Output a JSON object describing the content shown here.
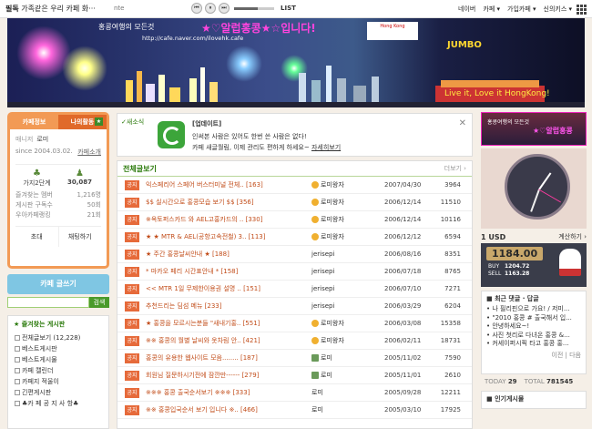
{
  "topbar": {
    "title_bold": "필독",
    "title_rest": "가족같은 우리 카페 화···",
    "music_name": "nte",
    "player_prev": "⏮",
    "player_pause": "⏸",
    "player_next": "⏭",
    "list_label": "LIST",
    "nav": [
      "네이버",
      "카페 ▾",
      "가입카페 ▾",
      "신의키스 ▾"
    ]
  },
  "banner": {
    "line1": "홍콩여행의 모든것",
    "url": "http://cafe.naver.com/ilovehk.cafe",
    "heading": "★♡알럽홍콩★☆입니다!",
    "logo_text": "Hong Kong",
    "jumbo": "JUMBO",
    "slogan": "Live it, Love it HongKong!"
  },
  "profile": {
    "tab_info": "카페정보",
    "tab_activity": "나의활동",
    "level": "매니저",
    "name": "로미",
    "since": "since 2004.03.02.",
    "intro_link": "카페소개",
    "stat1_label": "가지2단계",
    "stat2_value": "30,087",
    "list": [
      {
        "label": "즐겨찾는 멤버",
        "value": "1,216명"
      },
      {
        "label": "게시판 구독수",
        "value": "50회"
      },
      {
        "label": "우아카페랭킹",
        "value": "21회"
      }
    ],
    "btn_invite": "초대",
    "btn_chat": "채팅하기"
  },
  "write_button": "카페 글쓰기",
  "search_button": "검색",
  "favorites": {
    "heading": "즐겨찾는 게시판",
    "items": [
      "전체글보기 (12,228)",
      "베스트게시판",
      "베스트게시물",
      "카페 캘린더",
      "카페지 적울이",
      "긴편게시판",
      "♣카 페 공 지 사 항♣"
    ]
  },
  "notice": {
    "label": "새소식",
    "title": "[업데이트]",
    "line1": "인써본 사람은 있어도 한번 쓴 사람은 없다!",
    "line2": "카페 새글월림, 이제 관리도 편하게 하세요~",
    "line2_link": "자세히보기",
    "close": "✕"
  },
  "board": {
    "title": "전체글보기",
    "more": "더보기 ›",
    "tag": "공지",
    "rows": [
      {
        "title": "익스페리어 스페어 버스터미널 전체..",
        "count": "[163]",
        "author": "로미왕자",
        "face": "emoji",
        "date": "2007/04/30",
        "views": "3964"
      },
      {
        "title": "$$ 실시간으로 홍콩모습 보기 $$",
        "count": "[356]",
        "author": "로미왕자",
        "face": "emoji",
        "date": "2006/12/14",
        "views": "11510"
      },
      {
        "title": "※옥토퍼스카드 와 AEL고홍카드의 ..",
        "count": "[330]",
        "author": "로미왕자",
        "face": "emoji",
        "date": "2006/12/14",
        "views": "10116"
      },
      {
        "title": "★ ★ MTR & AEL(공항고속전철) 3..",
        "count": "[113]",
        "author": "로미왕자",
        "face": "emoji",
        "date": "2006/12/12",
        "views": "6594"
      },
      {
        "title": "★ 주간 홍콩날씨안내 ★",
        "count": "[188]",
        "author": "jerisepi",
        "face": "",
        "date": "2006/08/16",
        "views": "8351"
      },
      {
        "title": "* 마카오 페리 시간표안내 *",
        "count": "[158]",
        "author": "jerisepi",
        "face": "",
        "date": "2006/07/18",
        "views": "8765"
      },
      {
        "title": "<< MTR 1일 무제한이용권 설명 ..",
        "count": "[151]",
        "author": "jerisepi",
        "face": "",
        "date": "2006/07/10",
        "views": "7271"
      },
      {
        "title": "추천드리는 딤섬 메뉴",
        "count": "[233]",
        "author": "jerisepi",
        "face": "",
        "date": "2006/03/29",
        "views": "6204"
      },
      {
        "title": "★ 홍콩을 모르시는분들 \"새내기홍..",
        "count": "[551]",
        "author": "로미왕자",
        "face": "emoji",
        "date": "2006/03/08",
        "views": "15358"
      },
      {
        "title": "※※ 홍콩의 월별 날씨와 옷차림 안..",
        "count": "[421]",
        "author": "로미왕자",
        "face": "emoji",
        "date": "2006/02/11",
        "views": "18731"
      },
      {
        "title": "홍콩의 유용한 웹사이트 모음........",
        "count": "[187]",
        "author": "로미",
        "face": "pic",
        "date": "2005/11/02",
        "views": "7590"
      },
      {
        "title": "회원님 질문하시기전에 잠깐만------",
        "count": "[279]",
        "author": "로미",
        "face": "pic",
        "date": "2005/11/01",
        "views": "2610"
      },
      {
        "title": "※※※ 홍콩 출국순서보기 ※※※",
        "count": "[333]",
        "author": "로미",
        "face": "",
        "date": "2005/09/28",
        "views": "12211"
      },
      {
        "title": "※※ 홍콩입국순서 보기 입니다 ※..",
        "count": "[466]",
        "author": "로미",
        "face": "",
        "date": "2005/03/10",
        "views": "17925"
      }
    ]
  },
  "right": {
    "clip_title": "홍콩여행의 모든것",
    "clip_heading": "★♡알럽홍콩",
    "currency": "1 USD",
    "calc_label": "계산하기 ›",
    "rate": "1184.00",
    "buy_label": "BUY",
    "buy_value": "1204.72",
    "sell_label": "SELL",
    "sell_value": "1163.28",
    "comments_heading": "최근 댓글 · 답글",
    "comments": [
      "• 나 필리핀으로 가요! / 저미...",
      "• \"2010 홍콩 # 출국해서 입...",
      "• 안녕하세요~!",
      "• 사진 첫리로 다녀온 홍콩 &...",
      "• 커세이퍼시픽 타고 홍콩 홍..."
    ],
    "nav_prev": "이전",
    "nav_next": "다음",
    "today_label": "TODAY",
    "today_value": "29",
    "total_label": "TOTAL",
    "total_value": "781545",
    "popular": "인기게시물"
  }
}
